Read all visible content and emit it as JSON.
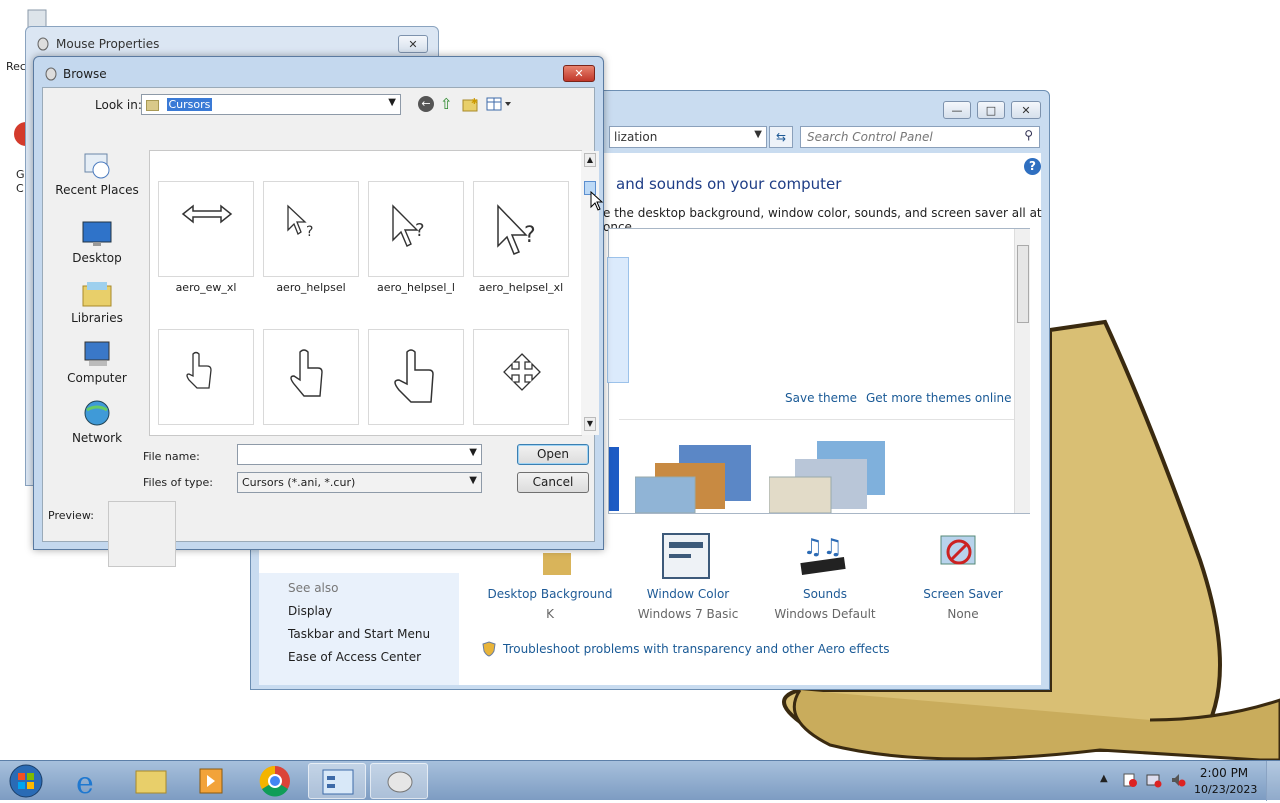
{
  "desktop": {
    "icon_labels": [
      "Rec",
      "G",
      "C"
    ]
  },
  "control_panel": {
    "address": "lization",
    "search_placeholder": "Search Control Panel",
    "heading": "and sounds on your computer",
    "subheading": "e the desktop background, window color, sounds, and screen saver all at once.",
    "save_theme": "Save theme",
    "get_more_themes": "Get more themes online",
    "see_also_title": "See also",
    "see_also_links": [
      "Display",
      "Taskbar and Start Menu",
      "Ease of Access Center"
    ],
    "tiles": [
      {
        "label": "Desktop Background",
        "value": "K"
      },
      {
        "label": "Window Color",
        "value": "Windows 7 Basic"
      },
      {
        "label": "Sounds",
        "value": "Windows Default"
      },
      {
        "label": "Screen Saver",
        "value": "None"
      }
    ],
    "troubleshoot_link": "Troubleshoot problems with transparency and other Aero effects"
  },
  "mouse_properties": {
    "title": "Mouse Properties"
  },
  "browse": {
    "title": "Browse",
    "look_in_label": "Look in:",
    "look_in_value": "Cursors",
    "places": [
      "Recent Places",
      "Desktop",
      "Libraries",
      "Computer",
      "Network"
    ],
    "files_row1": [
      "aero_ew_xl",
      "aero_helpsel",
      "aero_helpsel_l",
      "aero_helpsel_xl"
    ],
    "file_name_label": "File name:",
    "file_name_value": "",
    "files_of_type_label": "Files of type:",
    "files_of_type_value": "Cursors (*.ani, *.cur)",
    "open_label": "Open",
    "cancel_label": "Cancel",
    "preview_label": "Preview:"
  },
  "taskbar": {
    "time": "2:00 PM",
    "date": "10/23/2023"
  }
}
